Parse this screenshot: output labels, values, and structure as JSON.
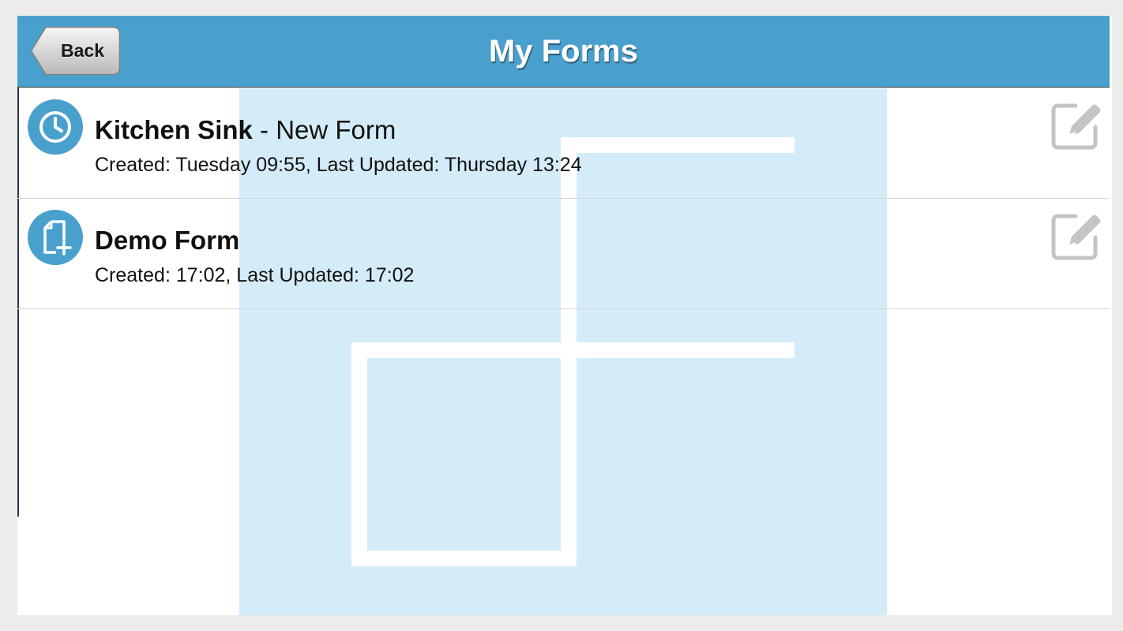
{
  "header": {
    "title": "My Forms",
    "back_label": "Back",
    "background_color": "#4aa0cd"
  },
  "forms": [
    {
      "name": "Kitchen Sink",
      "separator": " - ",
      "subtitle": "New Form",
      "meta": "Created: Tuesday 09:55, Last Updated: Thursday 13:24",
      "status_icon": "clock-icon",
      "action_icon": "edit-icon"
    },
    {
      "name": "Demo Form",
      "separator": "",
      "subtitle": "",
      "meta": "Created: 17:02, Last Updated: 17:02",
      "status_icon": "new-document-icon",
      "action_icon": "edit-icon"
    }
  ],
  "colors": {
    "accent": "#4aa0cd",
    "watermark": "#d4ecf8",
    "edit_icon": "#c4c4c4"
  }
}
